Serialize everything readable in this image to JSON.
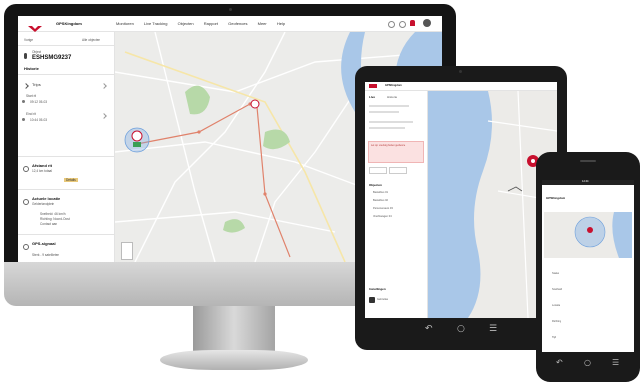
{
  "desktop": {
    "app_name": "GPSKingdom",
    "nav": [
      "Monitoren",
      "Live Tracking",
      "Objecten",
      "Rapport",
      "Geofences",
      "Meer",
      "Help"
    ],
    "sidebar": {
      "back_label": "Vorige",
      "back_right": "Alle objecten",
      "object_label": "Object",
      "object_name": "ESHSMG9237",
      "history_label": "Historie",
      "trips_label": "Trips",
      "start_label": "Start rit",
      "start_value": "09:12 05-03",
      "end_label": "Eind rit",
      "end_value": "10:44 05-03",
      "items": [
        {
          "title": "Afstand rit",
          "sub": "12,4 km totaal",
          "tag": "Details"
        },
        {
          "title": "Actuele locatie",
          "sub": "Gelderlandplein",
          "line1": "Snelheid: 46 km/h",
          "line2": "Richting: Noord-Oost",
          "line3": "Contact aan"
        },
        {
          "title": "GPS-signaal",
          "sub": "Sterk - 9 satellieten"
        }
      ]
    }
  },
  "tablet": {
    "app_name": "GPSKingdom",
    "tabs": [
      "Live",
      "Historie"
    ],
    "alert_text": "Let op: voertuig buiten geofence",
    "section": "Objecten",
    "objects": [
      "Bestelbus 01",
      "Bestelbus 02",
      "Personenauto 03",
      "Vrachtwagen 04"
    ],
    "footer_label": "Instellingen",
    "footer_sub": "Gebruiker"
  },
  "phone": {
    "time": "12:44",
    "title": "GPSKingdom",
    "fields": [
      "Status",
      "Snelheid",
      "Locatie",
      "Richting",
      "Tijd"
    ]
  },
  "colors": {
    "accent": "#c8102e",
    "map_water": "#a9c7e8",
    "map_land": "#ecebe8",
    "map_green": "#b7d9a8",
    "route": "#e0826b"
  }
}
